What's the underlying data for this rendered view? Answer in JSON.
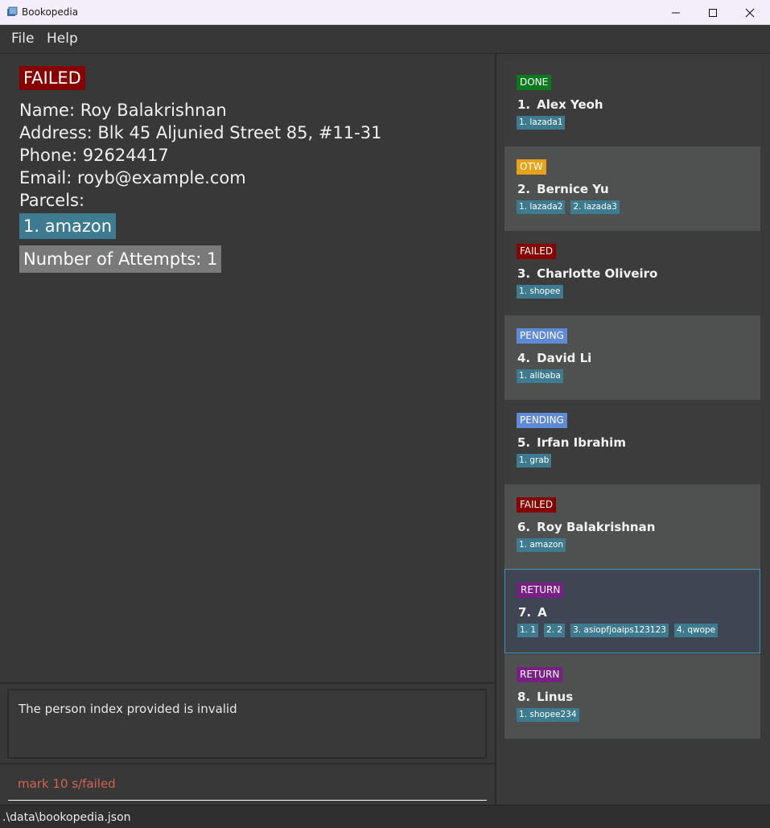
{
  "window": {
    "title": "Bookopedia",
    "minimize": "—",
    "maximize": "☐",
    "close": "✕"
  },
  "menu": {
    "file": "File",
    "help": "Help"
  },
  "colors": {
    "failed": "#860000",
    "done": "#0b7a1f",
    "otw": "#e8a21a",
    "pending": "#5f8ad6",
    "return": "#7a1f86",
    "parcel": "#3e7b91",
    "attempts": "#7a7a7a",
    "command": "#d06450"
  },
  "detail": {
    "status": "FAILED",
    "name": "Name: Roy Balakrishnan",
    "address": "Address: Blk 45 Aljunied Street 85, #11-31",
    "phone": "Phone: 92624417",
    "email": "Email: royb@example.com",
    "parcels_label": "Parcels:",
    "parcel": "1. amazon",
    "attempts": "Number of Attempts: 1"
  },
  "result": {
    "text": "The person index provided is invalid"
  },
  "command": {
    "text": "mark 10 s/failed"
  },
  "statusbar": {
    "path": ".\\data\\bookopedia.json"
  },
  "persons": [
    {
      "index": "1.",
      "name": "Alex Yeoh",
      "status": "DONE",
      "status_color": "#0b7a1f",
      "parcels": [
        "1. lazada1"
      ]
    },
    {
      "index": "2.",
      "name": "Bernice Yu",
      "status": "OTW",
      "status_color": "#e8a21a",
      "parcels": [
        "1. lazada2",
        "2. lazada3"
      ]
    },
    {
      "index": "3.",
      "name": "Charlotte Oliveiro",
      "status": "FAILED",
      "status_color": "#860000",
      "parcels": [
        "1. shopee"
      ]
    },
    {
      "index": "4.",
      "name": "David Li",
      "status": "PENDING",
      "status_color": "#5f8ad6",
      "parcels": [
        "1. alibaba"
      ]
    },
    {
      "index": "5.",
      "name": "Irfan Ibrahim",
      "status": "PENDING",
      "status_color": "#5f8ad6",
      "parcels": [
        "1. grab"
      ]
    },
    {
      "index": "6.",
      "name": "Roy Balakrishnan",
      "status": "FAILED",
      "status_color": "#860000",
      "parcels": [
        "1. amazon"
      ]
    },
    {
      "index": "7.",
      "name": "A",
      "status": "RETURN",
      "status_color": "#7a1f86",
      "parcels": [
        "1. 1",
        "2. 2",
        "3. asiopfjoaips123123",
        "4. qwope"
      ]
    },
    {
      "index": "8.",
      "name": "Linus",
      "status": "RETURN",
      "status_color": "#7a1f86",
      "parcels": [
        "1. shopee234"
      ]
    }
  ]
}
